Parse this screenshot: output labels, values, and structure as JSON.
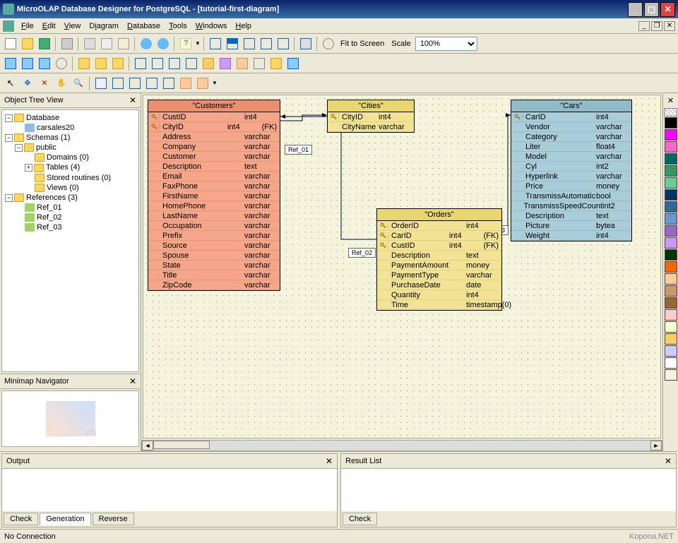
{
  "window": {
    "title": "MicroOLAP Database Designer for PostgreSQL - [tutorial-first-diagram]"
  },
  "menubar": {
    "items": [
      "File",
      "Edit",
      "View",
      "Diagram",
      "Database",
      "Tools",
      "Windows",
      "Help"
    ]
  },
  "toolbar2": {
    "fit_label": "Fit to Screen",
    "scale_label": "Scale",
    "scale_value": "100%"
  },
  "tree_panel": {
    "title": "Object Tree View",
    "nodes": {
      "database": "Database",
      "dbname": "carsales20",
      "schemas": "Schemas (1)",
      "public": "public",
      "domains": "Domains (0)",
      "tables": "Tables (4)",
      "stored": "Stored routines (0)",
      "views": "Views (0)",
      "references": "References (3)",
      "ref1": "Ref_01",
      "ref2": "Ref_02",
      "ref3": "Ref_03"
    }
  },
  "minimap": {
    "title": "Minimap Navigator"
  },
  "tables": {
    "customers": {
      "title": "\"Customers\"",
      "cols": [
        {
          "n": "CustID",
          "t": "int4",
          "k": true
        },
        {
          "n": "CityID",
          "t": "int4",
          "k": true,
          "fk": "(FK)"
        },
        {
          "n": "Address",
          "t": "varchar"
        },
        {
          "n": "Company",
          "t": "varchar"
        },
        {
          "n": "Customer",
          "t": "varchar"
        },
        {
          "n": "Description",
          "t": "text"
        },
        {
          "n": "Email",
          "t": "varchar"
        },
        {
          "n": "FaxPhone",
          "t": "varchar"
        },
        {
          "n": "FirstName",
          "t": "varchar"
        },
        {
          "n": "HomePhone",
          "t": "varchar"
        },
        {
          "n": "LastName",
          "t": "varchar"
        },
        {
          "n": "Occupation",
          "t": "varchar"
        },
        {
          "n": "Prefix",
          "t": "varchar"
        },
        {
          "n": "Source",
          "t": "varchar"
        },
        {
          "n": "Spouse",
          "t": "varchar"
        },
        {
          "n": "State",
          "t": "varchar"
        },
        {
          "n": "Title",
          "t": "varchar"
        },
        {
          "n": "ZipCode",
          "t": "varchar"
        }
      ]
    },
    "cities": {
      "title": "\"Cities\"",
      "cols": [
        {
          "n": "CityID",
          "t": "int4",
          "k": true
        },
        {
          "n": "CityName",
          "t": "varchar"
        }
      ]
    },
    "orders": {
      "title": "\"Orders\"",
      "cols": [
        {
          "n": "OrderID",
          "t": "int4",
          "k": true
        },
        {
          "n": "CarID",
          "t": "int4",
          "k": true,
          "fk": "(FK)"
        },
        {
          "n": "CustID",
          "t": "int4",
          "k": true,
          "fk": "(FK)"
        },
        {
          "n": "Description",
          "t": "text"
        },
        {
          "n": "PaymentAmount",
          "t": "money"
        },
        {
          "n": "PaymentType",
          "t": "varchar"
        },
        {
          "n": "PurchaseDate",
          "t": "date"
        },
        {
          "n": "Quantity",
          "t": "int4"
        },
        {
          "n": "Time",
          "t": "timestamp(0)"
        }
      ]
    },
    "cars": {
      "title": "\"Cars\"",
      "cols": [
        {
          "n": "CarID",
          "t": "int4",
          "k": true
        },
        {
          "n": "Vendor",
          "t": "varchar"
        },
        {
          "n": "Category",
          "t": "varchar"
        },
        {
          "n": "Liter",
          "t": "float4"
        },
        {
          "n": "Model",
          "t": "varchar"
        },
        {
          "n": "Cyl",
          "t": "int2"
        },
        {
          "n": "Hyperlink",
          "t": "varchar"
        },
        {
          "n": "Price",
          "t": "money"
        },
        {
          "n": "TransmissAutomatic",
          "t": "bool"
        },
        {
          "n": "TransmissSpeedCount",
          "t": "int2"
        },
        {
          "n": "Description",
          "t": "text"
        },
        {
          "n": "Picture",
          "t": "bytea"
        },
        {
          "n": "Weight",
          "t": "int4"
        }
      ]
    }
  },
  "refs": {
    "r1": "Ref_01",
    "r2": "Ref_02",
    "r3": "Ref_03"
  },
  "output": {
    "title": "Output",
    "tabs": [
      "Check",
      "Generation",
      "Reverse"
    ]
  },
  "result": {
    "title": "Result List",
    "tabs": [
      "Check"
    ]
  },
  "status": {
    "text": "No Connection"
  },
  "watermark": "Kopona.NET",
  "palette": [
    "#000000",
    "#ff00ff",
    "#ff66cc",
    "#006666",
    "#339966",
    "#66cc99",
    "#003366",
    "#336699",
    "#6699cc",
    "#9966cc",
    "#cc99ff",
    "#003300",
    "#ff6600",
    "#ffcc99",
    "#cc9966",
    "#996633",
    "#ffcccc",
    "#ffffcc",
    "#ffcc66",
    "#ccccff",
    "#ffffff",
    "#f5f5dc"
  ]
}
